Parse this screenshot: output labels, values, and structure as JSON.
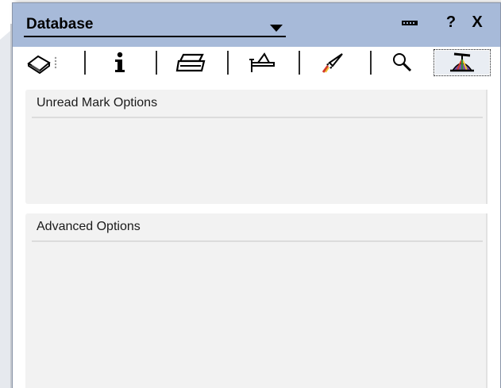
{
  "window": {
    "title": "Database",
    "minimize_glyph": "▬▬",
    "help_label": "?",
    "close_label": "X"
  },
  "tabs": [
    {
      "name": "basics-tab",
      "icon": "book-icon"
    },
    {
      "name": "info-tab",
      "icon": "info-icon"
    },
    {
      "name": "printing-tab",
      "icon": "printer-icon"
    },
    {
      "name": "design-tab",
      "icon": "t-square-icon"
    },
    {
      "name": "launch-tab",
      "icon": "rocket-icon"
    },
    {
      "name": "full-text-index-tab",
      "icon": "magnifier-icon"
    },
    {
      "name": "advanced-tab",
      "icon": "propeller-hat-icon",
      "selected": true
    }
  ],
  "sections": {
    "unread_mark_options": "Unread Mark Options",
    "advanced_options": "Advanced Options"
  },
  "colors": {
    "titlebar": "#a7bad9",
    "section_bg": "#f2f2f2",
    "tab_strip_bg": "#ffffff"
  }
}
